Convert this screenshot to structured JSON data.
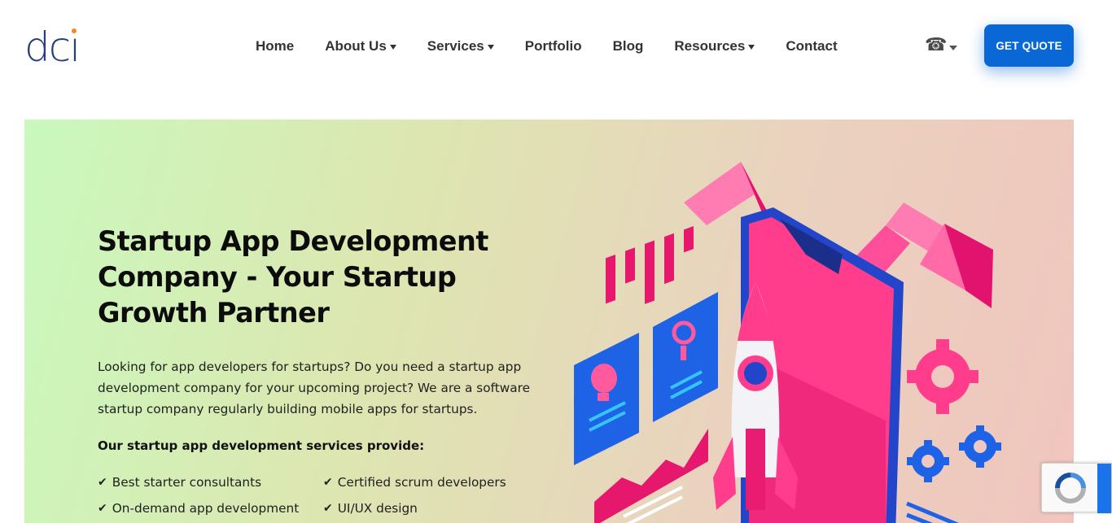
{
  "brand": {
    "logo_text": "dci"
  },
  "nav": {
    "items": [
      {
        "label": "Home",
        "dropdown": false
      },
      {
        "label": "About Us",
        "dropdown": true
      },
      {
        "label": "Services",
        "dropdown": true
      },
      {
        "label": "Portfolio",
        "dropdown": false
      },
      {
        "label": "Blog",
        "dropdown": false
      },
      {
        "label": "Resources",
        "dropdown": true
      },
      {
        "label": "Contact",
        "dropdown": false
      }
    ],
    "phone_icon": "phone-icon",
    "cta_label": "GET QUOTE"
  },
  "hero": {
    "title": "Startup App Development Company - Your Startup Growth Partner",
    "description": "Looking for app developers for startups? Do you need a startup app development company for your upcoming project? We are a software startup company regularly building mobile apps for startups.",
    "services_heading": "Our startup app development services provide:",
    "features": [
      "Best starter consultants",
      "Certified scrum developers",
      "On-demand app development",
      "UI/UX design"
    ]
  },
  "colors": {
    "accent": "#0a68d6",
    "logo": "#24407a",
    "logo_dot": "#f28b1e",
    "gradient_start": "#c9f9bd",
    "gradient_end": "#f0c5be"
  }
}
